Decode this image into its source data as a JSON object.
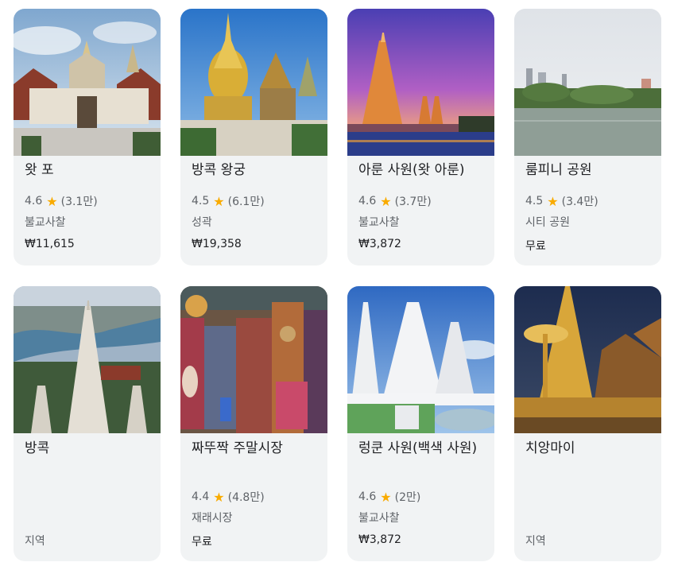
{
  "cards": [
    {
      "title": "왓 포",
      "rating": "4.6",
      "reviews": "(3.1만)",
      "type": "불교사찰",
      "price": "₩11,615"
    },
    {
      "title": "방콕 왕궁",
      "rating": "4.5",
      "reviews": "(6.1만)",
      "type": "성곽",
      "price": "₩19,358"
    },
    {
      "title": "아룬 사원(왓 아룬)",
      "rating": "4.6",
      "reviews": "(3.7만)",
      "type": "불교사찰",
      "price": "₩3,872"
    },
    {
      "title": "룸피니 공원",
      "rating": "4.5",
      "reviews": "(3.4만)",
      "type": "시티 공원",
      "price": "무료"
    },
    {
      "title": "방콕",
      "type": "지역"
    },
    {
      "title": "짜뚜짝 주말시장",
      "rating": "4.4",
      "reviews": "(4.8만)",
      "type": "재래시장",
      "price": "무료"
    },
    {
      "title": "렁쿤 사원(백색 사원)",
      "rating": "4.6",
      "reviews": "(2만)",
      "type": "불교사찰",
      "price": "₩3,872"
    },
    {
      "title": "치앙마이",
      "type": "지역"
    }
  ],
  "star_glyph": "★",
  "colors": {
    "star": "#f9ab00",
    "card_bg": "#f1f3f4"
  }
}
